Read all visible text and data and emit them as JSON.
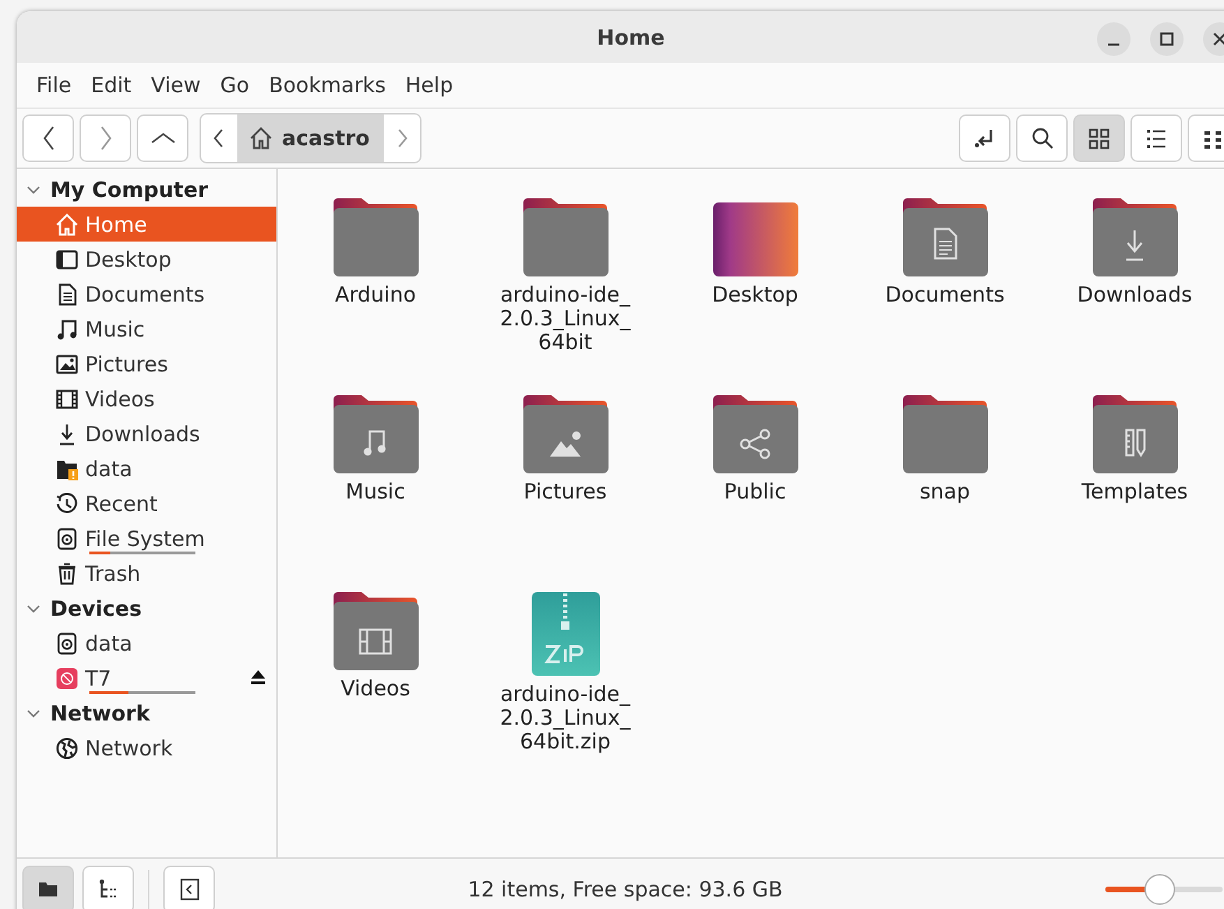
{
  "window": {
    "title": "Home"
  },
  "menu": [
    "File",
    "Edit",
    "View",
    "Go",
    "Bookmarks",
    "Help"
  ],
  "path": {
    "segments": [
      {
        "label": "acastro",
        "kind": "home",
        "selected": true
      }
    ]
  },
  "view_buttons": [
    {
      "kind": "grid",
      "selected": true
    },
    {
      "kind": "list",
      "selected": false
    },
    {
      "kind": "compact",
      "selected": false
    }
  ],
  "sidebar": [
    {
      "title": "My Computer",
      "expanded": true,
      "items": [
        {
          "label": "Home",
          "kind": "home",
          "selected": true
        },
        {
          "label": "Desktop",
          "kind": "desktop",
          "selected": false
        },
        {
          "label": "Documents",
          "kind": "document",
          "selected": false
        },
        {
          "label": "Music",
          "kind": "music",
          "selected": false
        },
        {
          "label": "Pictures",
          "kind": "picture",
          "selected": false
        },
        {
          "label": "Videos",
          "kind": "video",
          "selected": false
        },
        {
          "label": "Downloads",
          "kind": "download",
          "selected": false
        },
        {
          "label": "data",
          "kind": "folder-warning",
          "selected": false
        },
        {
          "label": "Recent",
          "kind": "recent",
          "selected": false
        },
        {
          "label": "File System",
          "kind": "drive",
          "selected": false,
          "level": 0.2
        },
        {
          "label": "Trash",
          "kind": "trash",
          "selected": false
        }
      ]
    },
    {
      "title": "Devices",
      "expanded": true,
      "items": [
        {
          "label": "data",
          "kind": "drive",
          "selected": false
        },
        {
          "label": "T7",
          "kind": "usb",
          "selected": false,
          "level": 0.37,
          "ejectable": true
        }
      ]
    },
    {
      "title": "Network",
      "expanded": true,
      "items": [
        {
          "label": "Network",
          "kind": "globe",
          "selected": false
        }
      ]
    }
  ],
  "files": [
    {
      "name": "Arduino",
      "kind": "folder"
    },
    {
      "name": "arduino-ide_ 2.0.3_Linux_ 64bit",
      "kind": "folder"
    },
    {
      "name": "Desktop",
      "kind": "desktop"
    },
    {
      "name": "Documents",
      "kind": "documents"
    },
    {
      "name": "Downloads",
      "kind": "downloads"
    },
    {
      "name": "Music",
      "kind": "music"
    },
    {
      "name": "Pictures",
      "kind": "pictures"
    },
    {
      "name": "Public",
      "kind": "public"
    },
    {
      "name": "snap",
      "kind": "folder"
    },
    {
      "name": "Templates",
      "kind": "templates"
    },
    {
      "name": "Videos",
      "kind": "videos"
    },
    {
      "name": "arduino-ide_ 2.0.3_Linux_ 64bit.zip",
      "kind": "zip"
    }
  ],
  "bottom_buttons": [
    {
      "kind": "places",
      "selected": true
    },
    {
      "kind": "tree",
      "selected": false
    }
  ],
  "status_bar": {
    "text": "12 items, Free space: 93.6 GB",
    "zoom": {
      "level": 0.45
    }
  }
}
